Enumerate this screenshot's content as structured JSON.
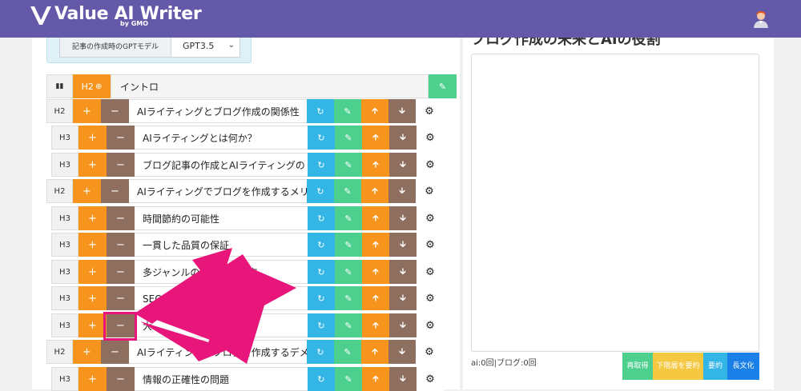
{
  "header": {
    "app_name": "Value AI Writer",
    "by": "by GMO",
    "avatar_icon": "user-avatar-icon"
  },
  "settings": {
    "gpt_label": "記事の作成時のGPTモデル",
    "gpt_value": "GPT3.5"
  },
  "intro": {
    "tag": "H2",
    "title": "イントロ"
  },
  "outline": [
    {
      "level": "H2",
      "title": "AIライティングとブログ作成の関係性"
    },
    {
      "level": "H3",
      "title": "AIライティングとは何か？"
    },
    {
      "level": "H3",
      "title": "ブログ記事の作成とAIライティングの"
    },
    {
      "level": "H2",
      "title": "AIライティングでブログを作成するメリ"
    },
    {
      "level": "H3",
      "title": "時間節約の可能性"
    },
    {
      "level": "H3",
      "title": "一貫した品質の保証"
    },
    {
      "level": "H3",
      "title": "多ジャンルの　　　　対応"
    },
    {
      "level": "H3",
      "title": "SEO対"
    },
    {
      "level": "H3",
      "title": "大"
    },
    {
      "level": "H2",
      "title": "AIライティングでブログを作成するデメ"
    },
    {
      "level": "H3",
      "title": "情報の正確性の問題"
    }
  ],
  "right": {
    "title": "ブログ作成の未来とAIの役割",
    "counter": "ai:0回|ブログ:0回",
    "buttons": [
      "再取得",
      "下階層を要約",
      "要約",
      "長文化"
    ]
  },
  "colors": {
    "header": "#6359a8",
    "plus": "#f7941d",
    "minus": "#8e6e5f",
    "refresh": "#33b5e5",
    "edit": "#4dcf8e",
    "annotation": "#e8157a"
  }
}
